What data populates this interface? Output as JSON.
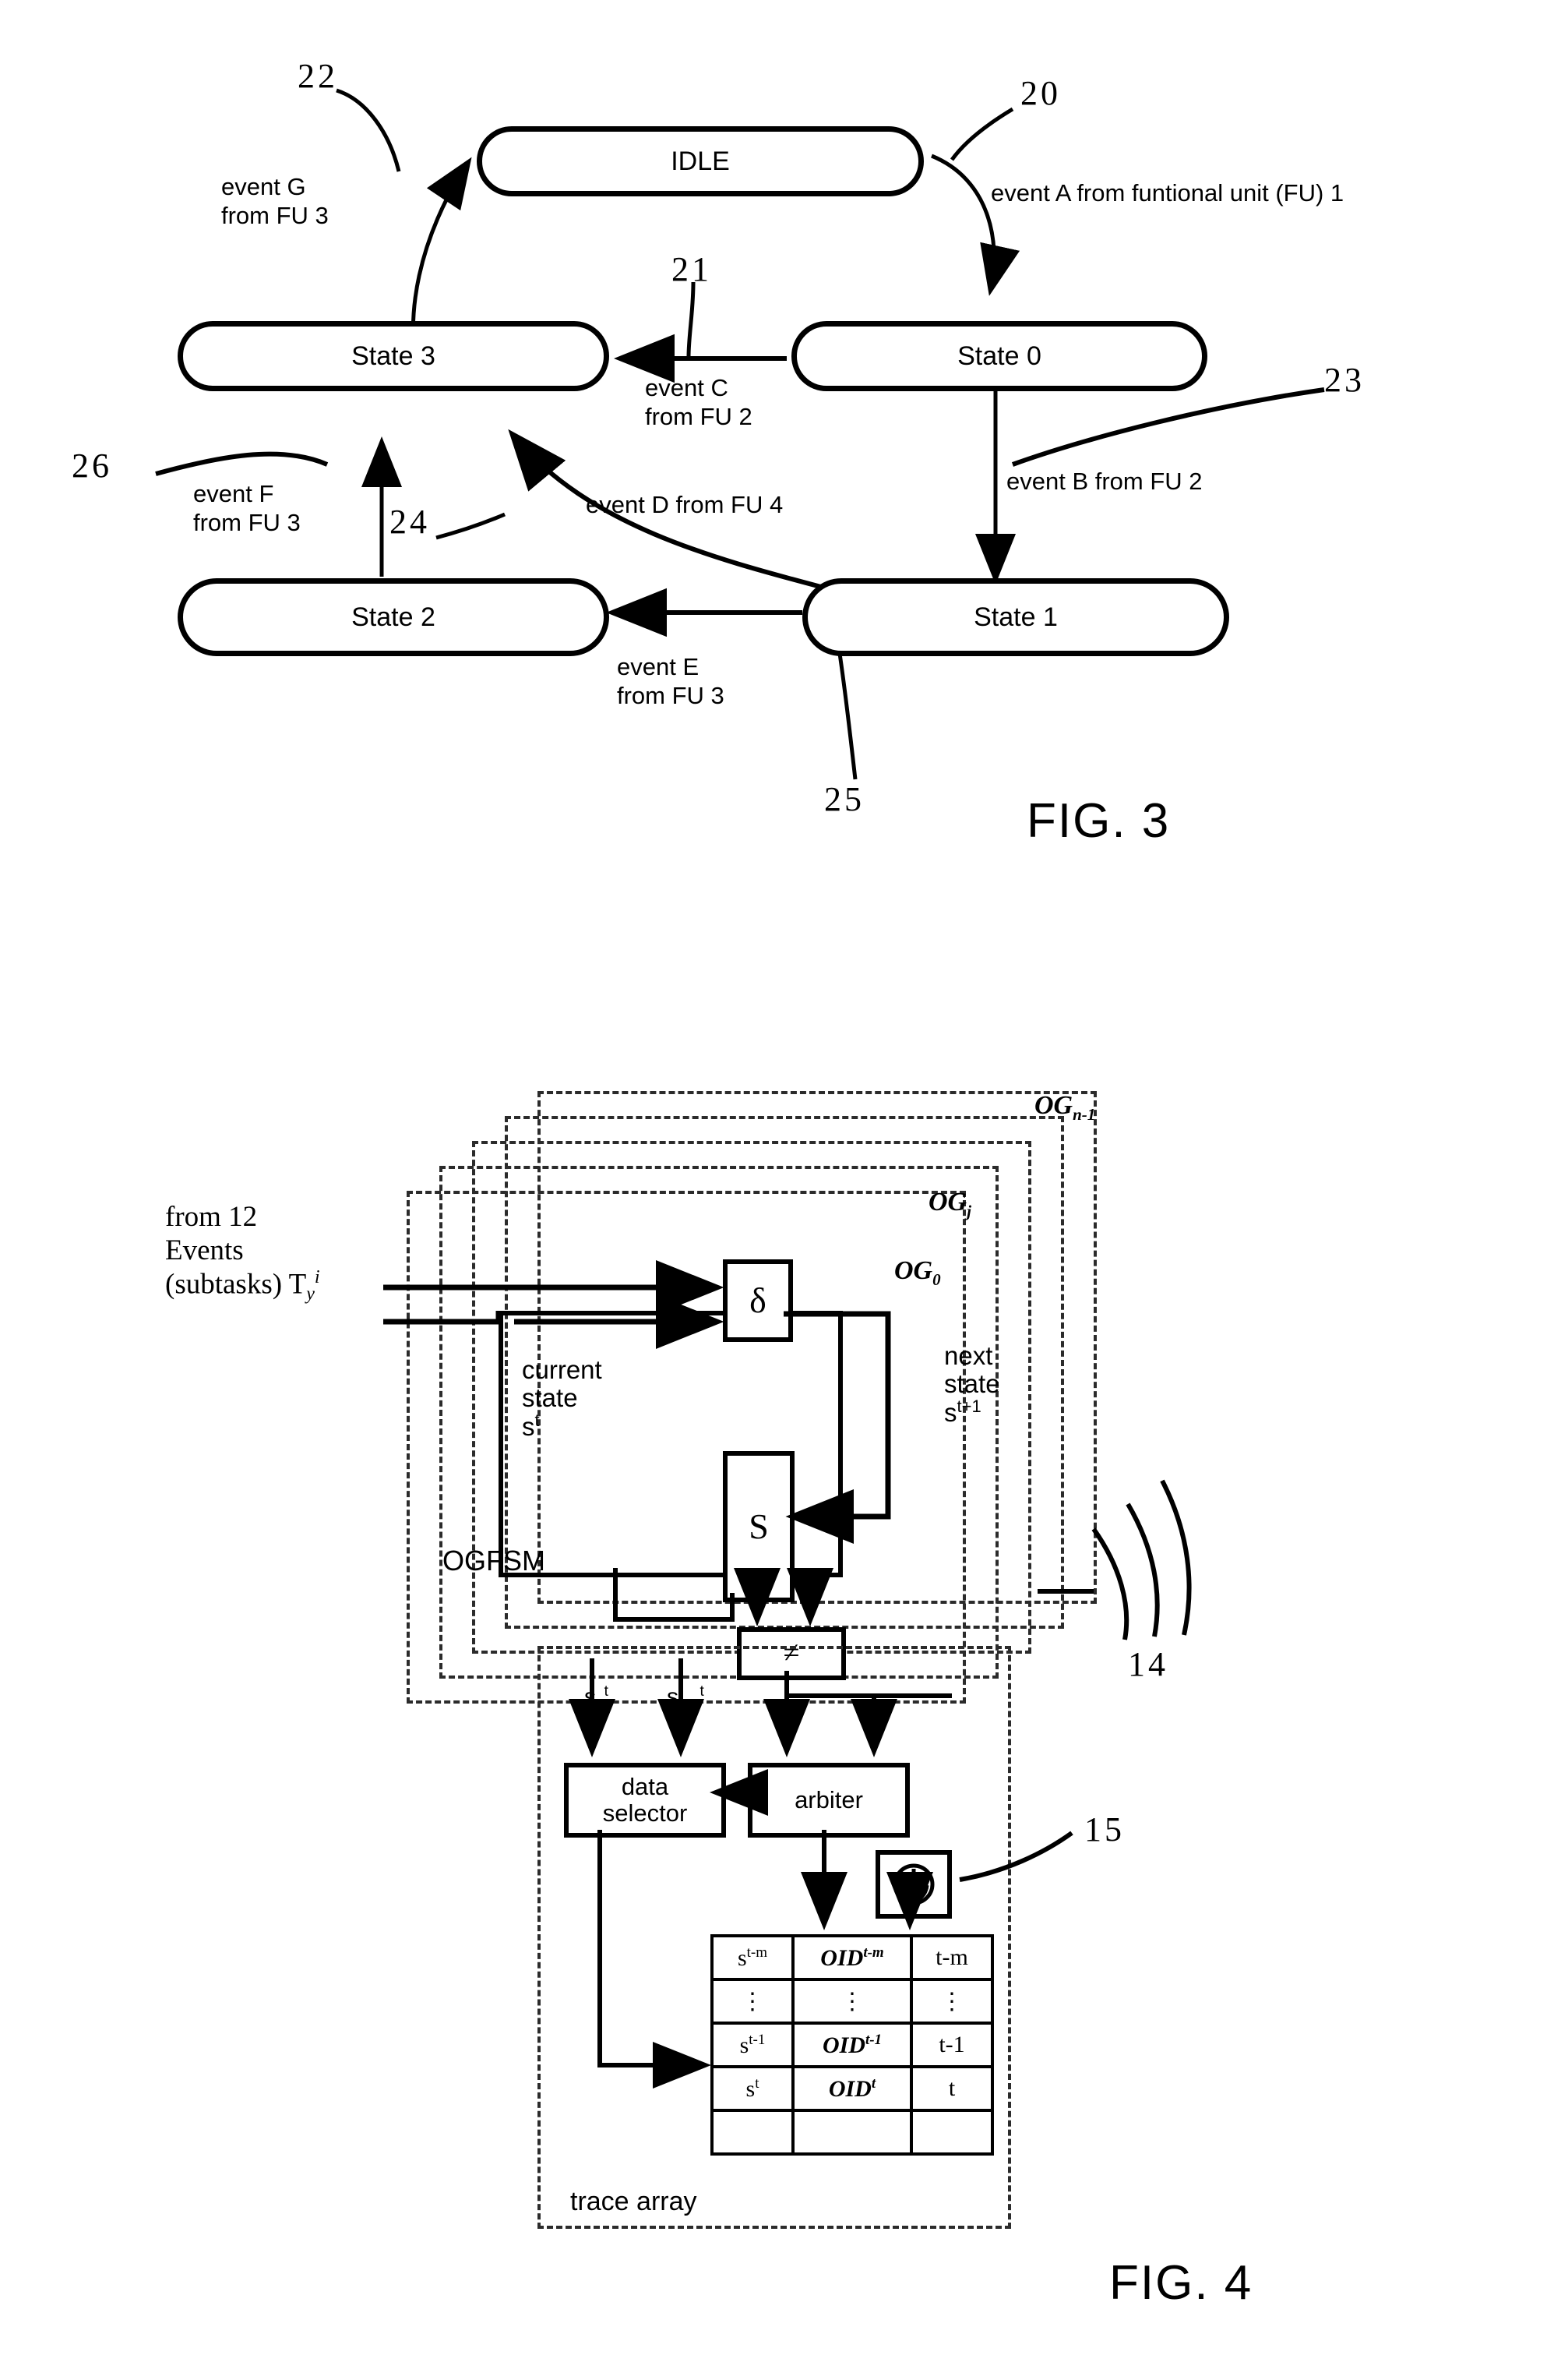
{
  "figures": [
    {
      "id": "fig3",
      "caption": "FIG. 3",
      "type": "state-transition-diagram",
      "states": [
        {
          "id": "idle",
          "label": "IDLE"
        },
        {
          "id": "state3",
          "label": "State 3"
        },
        {
          "id": "state0",
          "label": "State 0"
        },
        {
          "id": "state2",
          "label": "State 2"
        },
        {
          "id": "state1",
          "label": "State 1"
        }
      ],
      "transitions": [
        {
          "ref": "20",
          "from": "IDLE",
          "to": "State 0",
          "label": "event A from funtional unit (FU) 1"
        },
        {
          "ref": "21",
          "from": "State 0",
          "to": "State 3",
          "label": "event C\nfrom FU 2"
        },
        {
          "ref": "22",
          "from": "State 3",
          "to": "IDLE",
          "label": "event G\nfrom FU 3"
        },
        {
          "ref": "23",
          "from": "State 0",
          "to": "State 1",
          "label": "event B from FU 2"
        },
        {
          "ref": "24",
          "from": "State 1",
          "to": "State 3",
          "label": "event D from FU 4"
        },
        {
          "ref": "25",
          "from": "State 1",
          "to": "State 2",
          "label": "event E\nfrom FU 3"
        },
        {
          "ref": "26",
          "from": "State 2",
          "to": "State 3",
          "label": "event F\nfrom FU 3"
        }
      ],
      "reference_numerals": [
        "20",
        "21",
        "22",
        "23",
        "24",
        "25",
        "26"
      ]
    },
    {
      "id": "fig4",
      "caption": "FIG. 4",
      "type": "block-diagram",
      "input_label": "from 12\nEvents\n(subtasks) T",
      "input_sub": "y",
      "input_sup": "i",
      "og_groups": [
        {
          "id": "og_n1",
          "label": "OG",
          "sub": "n-1"
        },
        {
          "id": "og_j",
          "label": "OG",
          "sub": "j"
        },
        {
          "id": "og_0",
          "label": "OG",
          "sub": "0"
        }
      ],
      "blocks": [
        {
          "id": "delta",
          "label": "δ"
        },
        {
          "id": "s-register",
          "label": "S"
        },
        {
          "id": "comparator",
          "label": "≠"
        },
        {
          "id": "data-selector",
          "label": "data\nselector"
        },
        {
          "id": "arbiter",
          "label": "arbiter"
        },
        {
          "id": "clock",
          "label": "clock-icon"
        }
      ],
      "annotations": {
        "current_state": "current\nstate\ns",
        "current_state_sup": "t",
        "next_state": "next\nstate\ns",
        "next_state_sup": "t+1",
        "ogfsm": "OGFSM",
        "trace_array": "trace array"
      },
      "state_signals": [
        {
          "label": "s",
          "sub": "0",
          "sup": "t"
        },
        {
          "label": "s",
          "sub": "n-1",
          "sup": "t"
        }
      ],
      "reference_numerals": [
        "14",
        "15"
      ],
      "trace_table": {
        "columns": [
          "state",
          "oid",
          "time"
        ],
        "rows": [
          {
            "state": "s",
            "state_sup": "t-m",
            "oid": "OID",
            "oid_sup": "t-m",
            "time": "t-m"
          },
          {
            "state": "⋮",
            "state_sup": "",
            "oid": "⋮",
            "oid_sup": "",
            "time": "⋮"
          },
          {
            "state": "s",
            "state_sup": "t-1",
            "oid": "OID",
            "oid_sup": "t-1",
            "time": "t-1"
          },
          {
            "state": "s",
            "state_sup": "t",
            "oid": "OID",
            "oid_sup": "t",
            "time": "t"
          },
          {
            "state": "",
            "state_sup": "",
            "oid": "",
            "oid_sup": "",
            "time": ""
          }
        ]
      }
    }
  ],
  "colors": {
    "ink": "#000000",
    "paper": "#ffffff",
    "dashed": "#2b2b2b"
  }
}
